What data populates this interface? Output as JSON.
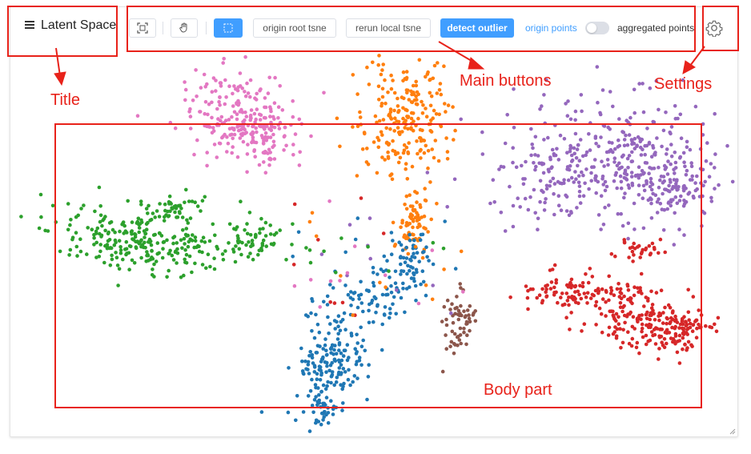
{
  "header": {
    "title": "Latent Space",
    "buttons": {
      "origin_root_tsne": "origin root tsne",
      "rerun_local_tsne": "rerun local tsne",
      "detect_outlier": "detect outlier"
    },
    "origin_points": "origin points",
    "aggregated_points": "aggregated points",
    "aggregated_on": false
  },
  "annotations": {
    "title": "Title",
    "main_buttons": "Main buttons",
    "settings": "Settings",
    "body_part": "Body part"
  },
  "colors": {
    "annotation_red": "#e8221a",
    "primary_blue": "#409eff",
    "clusters": {
      "blue": "#1f77b4",
      "orange": "#ff7f0e",
      "green": "#2ca02c",
      "red": "#d62728",
      "purple": "#9467bd",
      "brown": "#8c564b",
      "pink": "#e377c2"
    }
  }
}
